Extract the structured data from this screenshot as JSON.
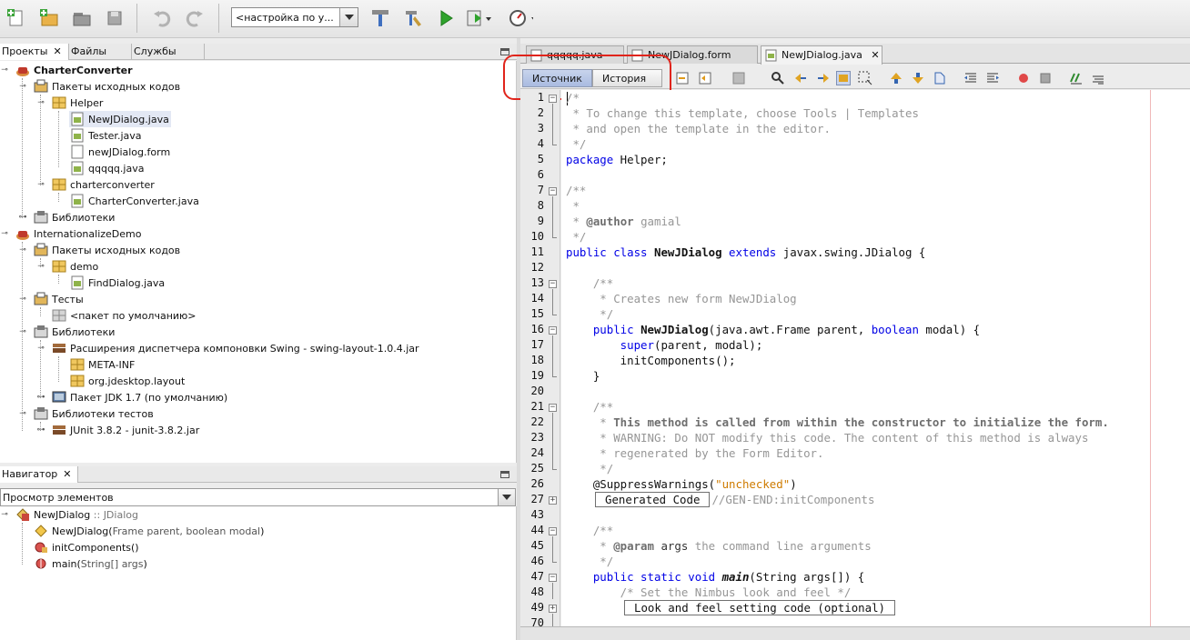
{
  "toolbar": {
    "config_combo": "<настройка по у...",
    "icons": [
      "new-file-icon",
      "new-project-icon",
      "open-project-icon",
      "save-all-icon",
      "undo-icon",
      "redo-icon",
      "build-icon",
      "clean-build-icon",
      "run-icon",
      "debug-icon",
      "profile-icon"
    ]
  },
  "projects_panel": {
    "tabs": [
      {
        "label": "Проекты",
        "close": "✕"
      },
      {
        "label": "Файлы"
      },
      {
        "label": "Службы"
      }
    ],
    "tree": [
      {
        "label": "CharterConverter",
        "bold": true
      },
      {
        "label": "Пакеты исходных кодов"
      },
      {
        "label": "Helper"
      },
      {
        "label": "NewJDialog.java"
      },
      {
        "label": "Tester.java"
      },
      {
        "label": "newJDialog.form"
      },
      {
        "label": "qqqqq.java"
      },
      {
        "label": "charterconverter"
      },
      {
        "label": "CharterConverter.java"
      },
      {
        "label": "Библиотеки"
      },
      {
        "label": "InternationalizeDemo"
      },
      {
        "label": "Пакеты исходных кодов"
      },
      {
        "label": "demo"
      },
      {
        "label": "FindDialog.java"
      },
      {
        "label": "Тесты"
      },
      {
        "label": "<пакет по умолчанию>"
      },
      {
        "label": "Библиотеки"
      },
      {
        "label": "Расширения диспетчера компоновки Swing - swing-layout-1.0.4.jar"
      },
      {
        "label": "META-INF"
      },
      {
        "label": "org.jdesktop.layout"
      },
      {
        "label": "Пакет JDK 1.7 (по умолчанию)"
      },
      {
        "label": "Библиотеки тестов"
      },
      {
        "label": "JUnit 3.8.2 - junit-3.8.2.jar"
      }
    ]
  },
  "navigator_panel": {
    "tab": "Навигатор",
    "close": "✕",
    "combo": "Просмотр элементов",
    "root": "NewJDialog",
    "root_type": ":: JDialog",
    "items": [
      {
        "name": "NewJDialog(",
        "params": "Frame parent, boolean modal",
        "close": ")"
      },
      {
        "name": "initComponents()",
        "params": "",
        "close": ""
      },
      {
        "name": "main(",
        "params": "String[] args",
        "close": ")"
      }
    ]
  },
  "editor": {
    "tabs": [
      {
        "label": "qqqqq.java"
      },
      {
        "label": "NewJDialog.form"
      },
      {
        "label": "NewJDialog.java",
        "close": "✕"
      }
    ],
    "view_source": "Источник",
    "view_history": "История",
    "line_numbers": [
      "1",
      "2",
      "3",
      "4",
      "5",
      "6",
      "7",
      "8",
      "9",
      "10",
      "11",
      "12",
      "13",
      "14",
      "15",
      "16",
      "17",
      "18",
      "19",
      "20",
      "21",
      "22",
      "23",
      "24",
      "25",
      "26",
      "27",
      "43",
      "44",
      "45",
      "46",
      "47",
      "48",
      "49",
      "70"
    ],
    "code": {
      "l1": "/*",
      "l2": " * To change this template, choose Tools | Templates",
      "l3": " * and open the template in the editor.",
      "l4": " */",
      "l5_kw": "package",
      "l5_rest": " Helper;",
      "l7": "/**",
      "l8": " *",
      "l9_a": " * ",
      "l9_tag": "@author",
      "l9_b": " gamial",
      "l10": " */",
      "l11_kw1": "public class ",
      "l11_name": "NewJDialog",
      "l11_kw2": " extends",
      "l11_rest": " javax.swing.JDialog {",
      "l13": "    /**",
      "l14": "     * Creates new form NewJDialog",
      "l15": "     */",
      "l16_kw": "    public ",
      "l16_name": "NewJDialog",
      "l16_a": "(java.awt.Frame parent, ",
      "l16_kw2": "boolean",
      "l16_b": " modal) {",
      "l17_kw": "        super",
      "l17_rest": "(parent, modal);",
      "l18": "        initComponents();",
      "l19": "    }",
      "l21": "    /**",
      "l22_a": "     * ",
      "l22_b": "This method is called from within the constructor to initialize the form.",
      "l23": "     * WARNING: Do NOT modify this code. The content of this method is always",
      "l24": "     * regenerated by the Form Editor.",
      "l25": "     */",
      "l26_a": "    @SuppressWarnings(",
      "l26_str": "\"unchecked\"",
      "l26_b": ")",
      "l27_box": "Generated Code",
      "l27_cm": "//GEN-END:initComponents",
      "l44": "    /**",
      "l45_a": "     * ",
      "l45_tag": "@param",
      "l45_name": " args",
      "l45_b": " the command line arguments",
      "l46": "     */",
      "l47_kw": "    public static void ",
      "l47_name": "main",
      "l47_rest": "(String args[]) {",
      "l48": "        /* Set the Nimbus look and feel */",
      "l49_box": "Look and feel setting code (optional)"
    }
  },
  "colors": {
    "keyword": "#0000e6",
    "comment": "#969696",
    "string": "#ce7b00",
    "highlight_circle": "#e0241b"
  }
}
